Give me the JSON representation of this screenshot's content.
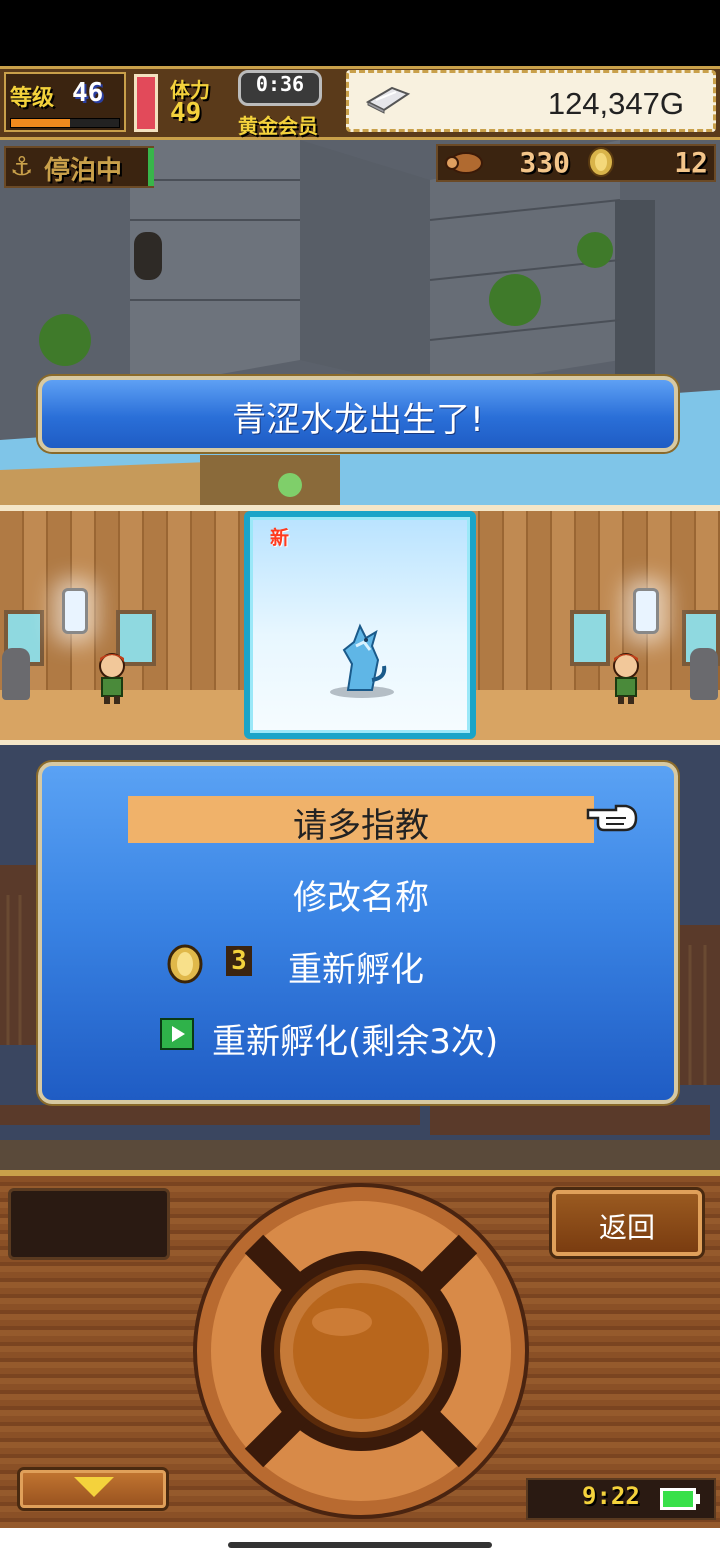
{
  "hud": {
    "level_label": "等级",
    "level_value": "46",
    "level_progress": 0.55,
    "stamina_label": "体力",
    "stamina_value": "49",
    "timer": "0:36",
    "member_status": "黄金会员",
    "money": "124,347G"
  },
  "status_row": {
    "dock_status": "停泊中",
    "resource1_value": "330",
    "resource2_value": "12"
  },
  "banner": {
    "text": "青涩水龙出生了!"
  },
  "creature_card": {
    "new_tag": "新"
  },
  "menu": {
    "options": [
      {
        "label": "请多指教"
      },
      {
        "label": "修改名称"
      },
      {
        "label": "重新孵化",
        "cost": "3"
      },
      {
        "label": "重新孵化(剩余3次)"
      }
    ],
    "selected_index": 0
  },
  "controls": {
    "back_label": "返回",
    "clock": "9:22"
  },
  "colors": {
    "panel_blue": "#3a84e4",
    "highlight": "#f0b26a",
    "gold": "#f4d23c",
    "card_border": "#1aa4c8"
  },
  "icons": [
    "anchor-icon",
    "silver-bar-icon",
    "grain-sack-icon",
    "coin-icon",
    "hand-pointer-icon",
    "play-icon",
    "down-arrow-icon",
    "battery-icon"
  ]
}
